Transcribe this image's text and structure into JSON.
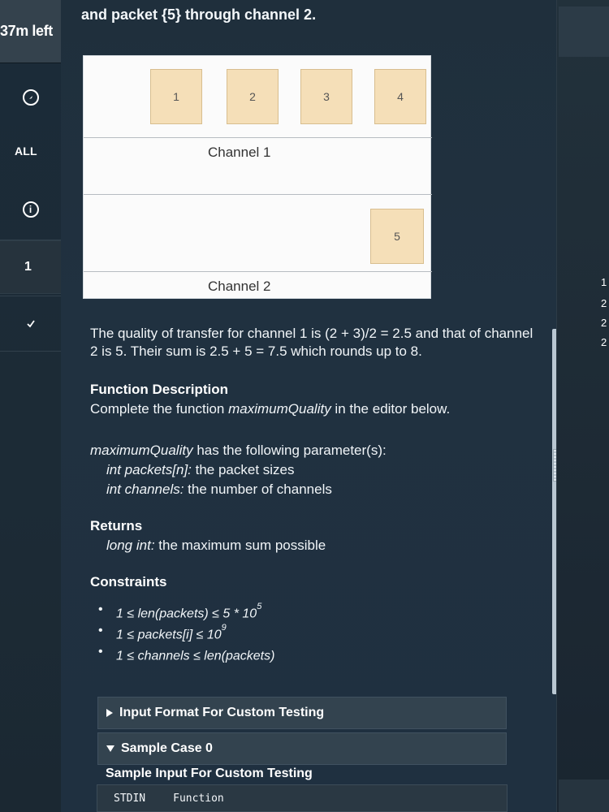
{
  "left_rail": {
    "timer": "37m left",
    "all_label": "ALL",
    "question_number": "1"
  },
  "problem": {
    "heading_snippet": "and packet {5} through channel 2.",
    "diagram": {
      "packets_channel1": [
        "1",
        "2",
        "3",
        "4"
      ],
      "packet_channel2": "5",
      "channel1_label": "Channel 1",
      "channel2_label": "Channel 2"
    },
    "explanation": "The quality of transfer for channel 1 is (2 + 3)/2 = 2.5 and that of channel 2 is 5. Their sum is 2.5 + 5 = 7.5 which rounds up to 8.",
    "function_description_title": "Function Description",
    "function_description_text_prefix": "Complete the function ",
    "function_name": "maximumQuality",
    "function_description_text_suffix": " in the editor below.",
    "params_intro_suffix": " has the following parameter(s):",
    "param1_term": "int packets[n]:",
    "param1_desc": " the packet sizes",
    "param2_term": "int channels:",
    "param2_desc": " the number of channels",
    "returns_title": "Returns",
    "returns_term": "long int:",
    "returns_desc": " the maximum sum possible",
    "constraints_title": "Constraints",
    "constraints": [
      {
        "text": "1 ≤ len(packets) ≤ 5 * 10",
        "sup": "5"
      },
      {
        "text": "1 ≤ packets[i] ≤ 10",
        "sup": "9"
      },
      {
        "text": "1 ≤ channels ≤ len(packets)",
        "sup": ""
      }
    ]
  },
  "sections": {
    "input_format": "Input Format For Custom Testing",
    "sample_case": "Sample Case 0",
    "sample_input_title": "Sample Input For Custom Testing",
    "stdin_label": "STDIN",
    "function_label": "Function"
  },
  "right_gutter": [
    "1",
    "2",
    "2",
    "2"
  ]
}
